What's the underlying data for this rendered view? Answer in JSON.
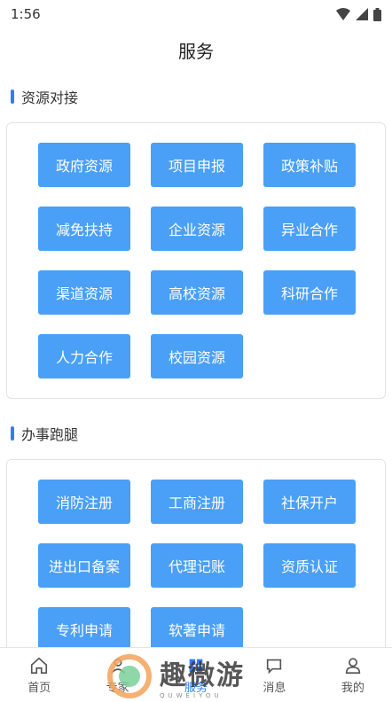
{
  "status": {
    "time": "1:56"
  },
  "header": {
    "title": "服务"
  },
  "sections": [
    {
      "title": "资源对接",
      "items": [
        "政府资源",
        "项目申报",
        "政策补贴",
        "减免扶持",
        "企业资源",
        "异业合作",
        "渠道资源",
        "高校资源",
        "科研合作",
        "人力合作",
        "校园资源"
      ]
    },
    {
      "title": "办事跑腿",
      "items": [
        "消防注册",
        "工商注册",
        "社保开户",
        "进出口备案",
        "代理记账",
        "资质认证",
        "专利申请",
        "软著申请"
      ]
    }
  ],
  "tabbar": [
    {
      "label": "首页",
      "icon": "home-icon",
      "active": false
    },
    {
      "label": "专家",
      "icon": "expert-icon",
      "active": false
    },
    {
      "label": "服务",
      "icon": "service-icon",
      "active": true
    },
    {
      "label": "消息",
      "icon": "message-icon",
      "active": false
    },
    {
      "label": "我的",
      "icon": "profile-icon",
      "active": false
    }
  ],
  "watermark": {
    "text": "趣微游",
    "sub": "QUWEIYOU"
  },
  "colors": {
    "accent": "#2f7df6",
    "button": "#4a9ff6"
  }
}
